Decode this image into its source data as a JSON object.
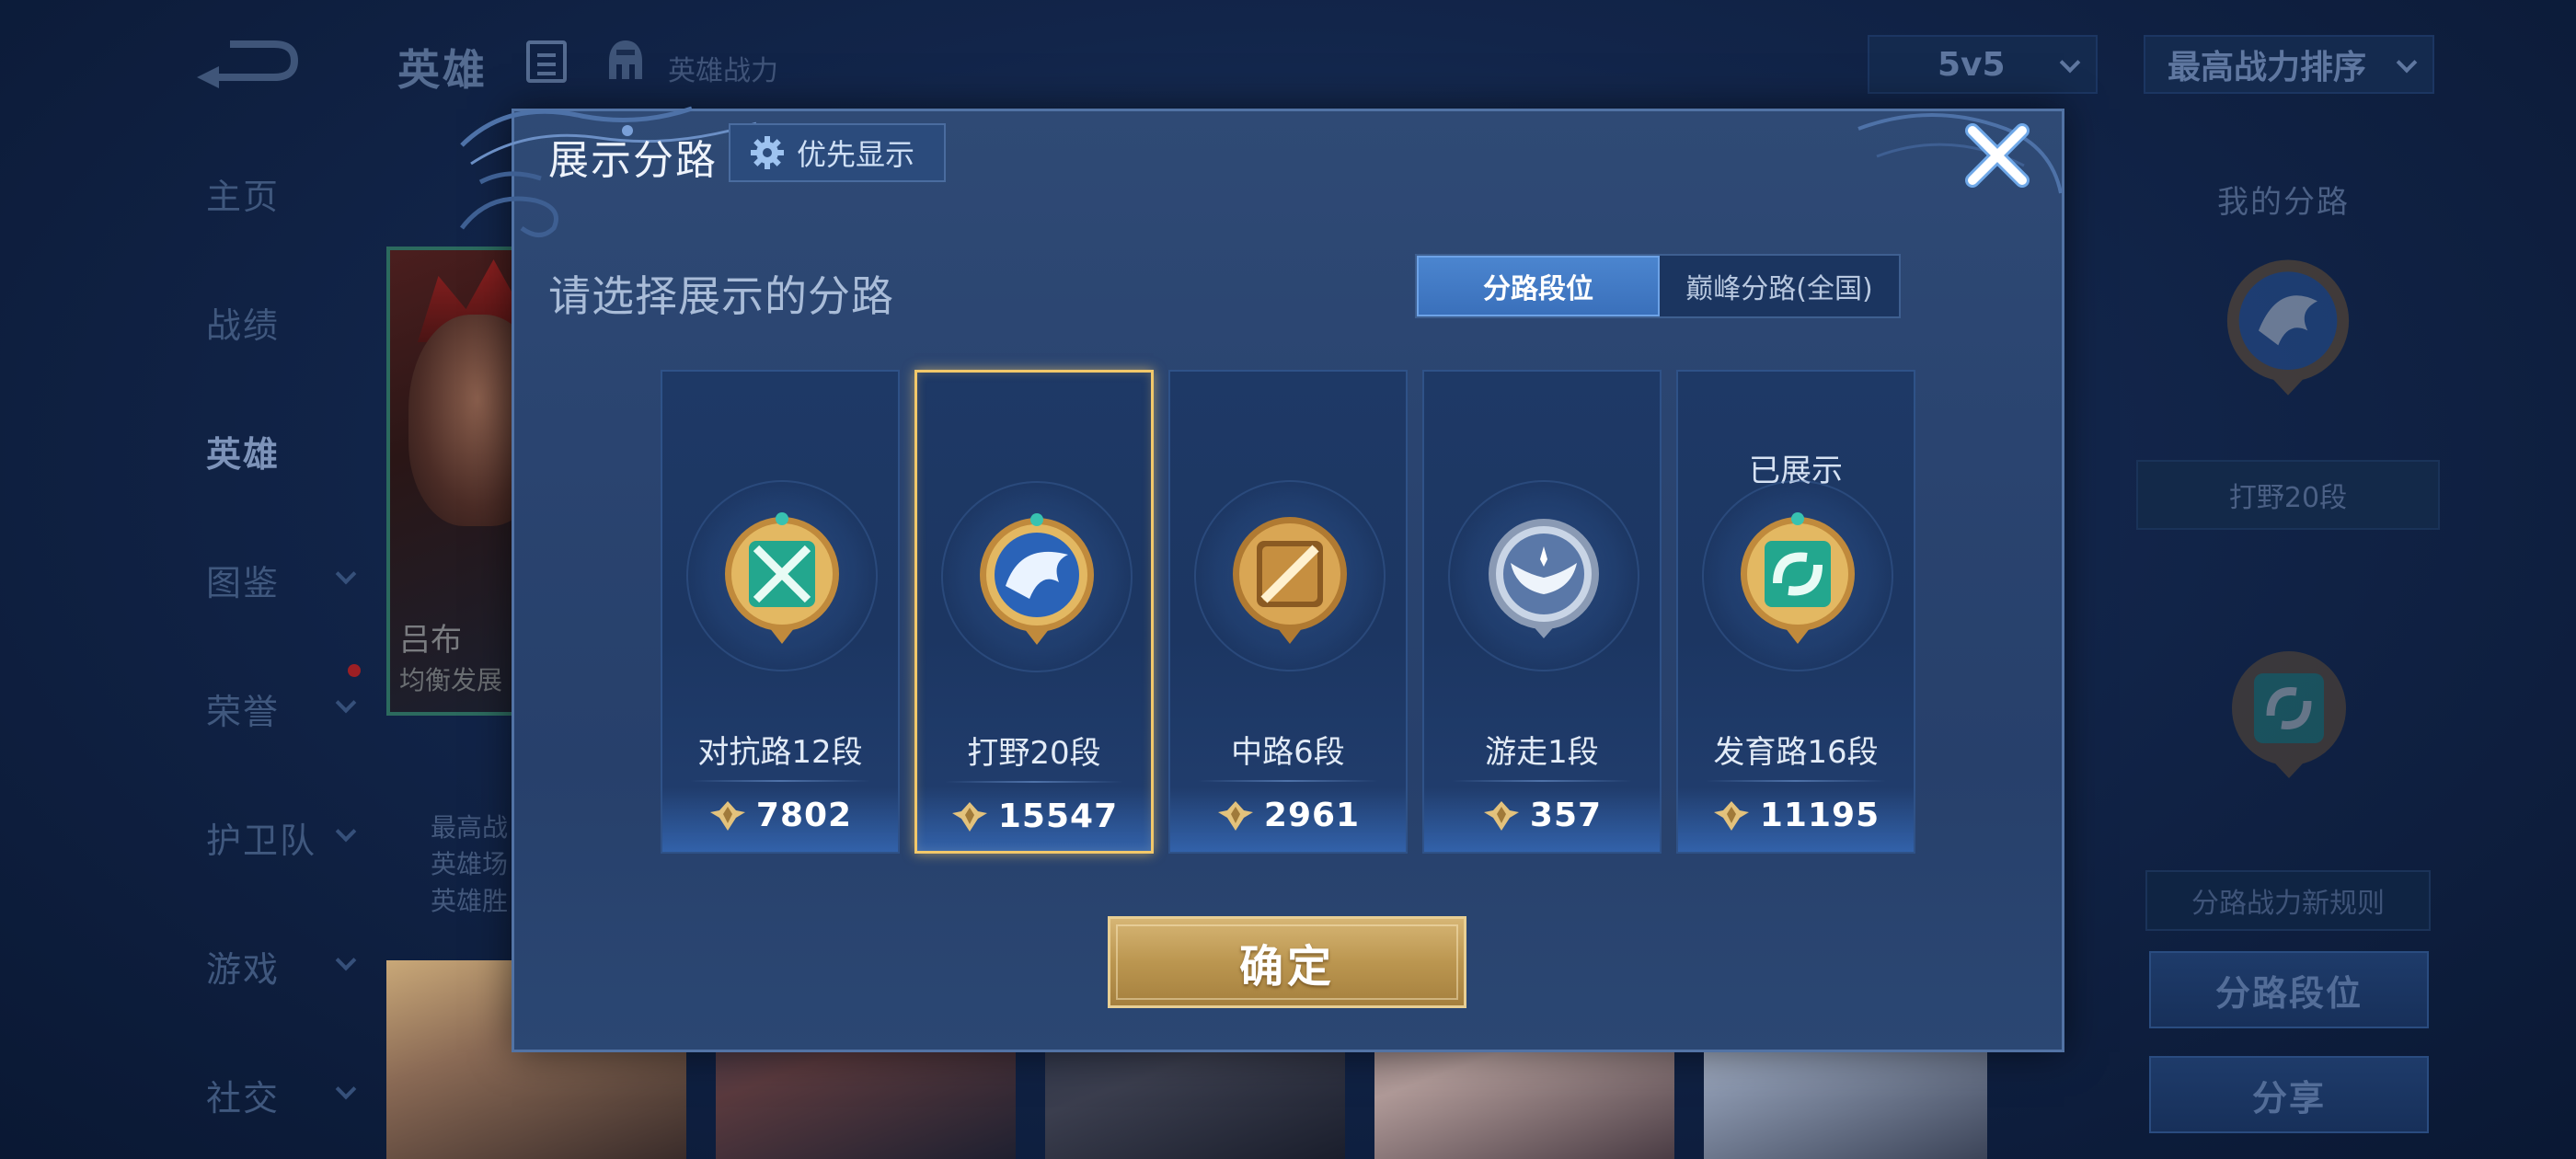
{
  "header": {
    "title": "英雄",
    "power_label": "英雄战力",
    "mode_value": "5v5",
    "sort_value": "最高战力排序"
  },
  "sidebar": {
    "items": [
      {
        "label": "主页",
        "has_chevron": false
      },
      {
        "label": "战绩",
        "has_chevron": false
      },
      {
        "label": "英雄",
        "has_chevron": false,
        "active": true
      },
      {
        "label": "图鉴",
        "has_chevron": true
      },
      {
        "label": "荣誉",
        "has_chevron": true
      },
      {
        "label": "护卫队",
        "has_chevron": true
      },
      {
        "label": "游戏",
        "has_chevron": true
      },
      {
        "label": "社交",
        "has_chevron": true
      }
    ]
  },
  "hero_card": {
    "name": "吕布",
    "subtitle": "均衡发展",
    "stats": [
      "最高战",
      "英雄场",
      "英雄胜"
    ]
  },
  "right_panel": {
    "title": "我的分路",
    "jungle_label": "打野20段",
    "rule_label": "分路战力新规则",
    "lane_button": "分路段位",
    "share_button": "分享"
  },
  "modal": {
    "title": "展示分路",
    "priority_button": "优先显示",
    "prompt": "请选择展示的分路",
    "tabs": [
      {
        "label": "分路段位",
        "active": true
      },
      {
        "label": "巅峰分路(全国)",
        "active": false
      }
    ],
    "lanes": [
      {
        "name": "对抗路12段",
        "score": "7802",
        "badge": "clash-lane-badge-icon",
        "selected": false,
        "shown_label": ""
      },
      {
        "name": "打野20段",
        "score": "15547",
        "badge": "jungle-dragon-badge-icon",
        "selected": true,
        "shown_label": ""
      },
      {
        "name": "中路6段",
        "score": "2961",
        "badge": "mid-lane-badge-icon",
        "selected": false,
        "shown_label": ""
      },
      {
        "name": "游走1段",
        "score": "357",
        "badge": "roam-wings-badge-icon",
        "selected": false,
        "shown_label": ""
      },
      {
        "name": "发育路16段",
        "score": "11195",
        "badge": "farm-lane-badge-icon",
        "selected": false,
        "shown_label": "已展示"
      }
    ],
    "confirm_button": "确定"
  },
  "colors": {
    "accent_gold": "#d6b574",
    "selected_border": "#f2c86a",
    "tab_active": "#4b85cf",
    "modal_bg": "#2a4470"
  }
}
